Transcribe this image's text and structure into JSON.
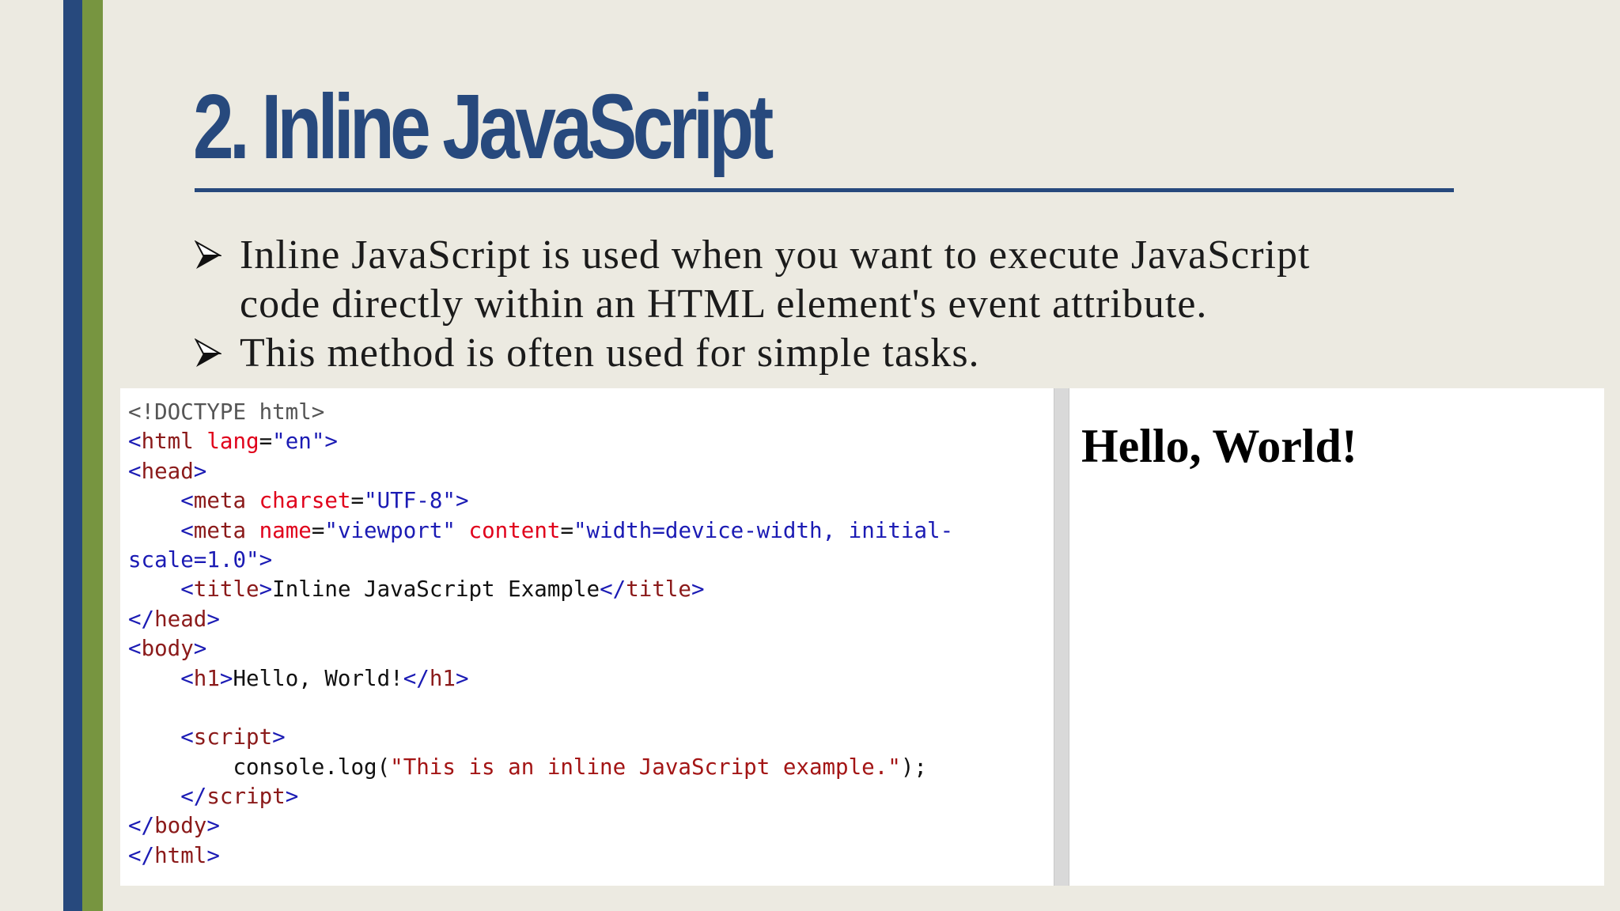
{
  "slide": {
    "title": "2. Inline JavaScript",
    "bullets": [
      {
        "lines": [
          "Inline JavaScript is used when you want to execute JavaScript",
          "code directly within an HTML element's event attribute."
        ],
        "icon": "arrow-bullet-icon"
      },
      {
        "lines": [
          "This method is often used for simple tasks."
        ],
        "icon": "arrow-bullet-icon"
      }
    ]
  },
  "code_example": {
    "lines": [
      [
        {
          "t": "<!DOCTYPE html>",
          "c": "doctype"
        }
      ],
      [
        {
          "t": "<",
          "c": "punct"
        },
        {
          "t": "html",
          "c": "tag"
        },
        {
          "t": " ",
          "c": "text"
        },
        {
          "t": "lang",
          "c": "attr"
        },
        {
          "t": "=",
          "c": "text"
        },
        {
          "t": "\"en\"",
          "c": "val"
        },
        {
          "t": ">",
          "c": "punct"
        }
      ],
      [
        {
          "t": "<",
          "c": "punct"
        },
        {
          "t": "head",
          "c": "tag"
        },
        {
          "t": ">",
          "c": "punct"
        }
      ],
      [
        {
          "t": "    ",
          "c": "text"
        },
        {
          "t": "<",
          "c": "punct"
        },
        {
          "t": "meta",
          "c": "tag"
        },
        {
          "t": " ",
          "c": "text"
        },
        {
          "t": "charset",
          "c": "attr"
        },
        {
          "t": "=",
          "c": "text"
        },
        {
          "t": "\"UTF-8\"",
          "c": "val"
        },
        {
          "t": ">",
          "c": "punct"
        }
      ],
      [
        {
          "t": "    ",
          "c": "text"
        },
        {
          "t": "<",
          "c": "punct"
        },
        {
          "t": "meta",
          "c": "tag"
        },
        {
          "t": " ",
          "c": "text"
        },
        {
          "t": "name",
          "c": "attr"
        },
        {
          "t": "=",
          "c": "text"
        },
        {
          "t": "\"viewport\"",
          "c": "val"
        },
        {
          "t": " ",
          "c": "text"
        },
        {
          "t": "content",
          "c": "attr"
        },
        {
          "t": "=",
          "c": "text"
        },
        {
          "t": "\"width=device-width, initial-",
          "c": "val"
        }
      ],
      [
        {
          "t": "scale=1.0\"",
          "c": "val"
        },
        {
          "t": ">",
          "c": "punct"
        }
      ],
      [
        {
          "t": "    ",
          "c": "text"
        },
        {
          "t": "<",
          "c": "punct"
        },
        {
          "t": "title",
          "c": "tag"
        },
        {
          "t": ">",
          "c": "punct"
        },
        {
          "t": "Inline JavaScript Example",
          "c": "text"
        },
        {
          "t": "</",
          "c": "punct"
        },
        {
          "t": "title",
          "c": "tag"
        },
        {
          "t": ">",
          "c": "punct"
        }
      ],
      [
        {
          "t": "</",
          "c": "punct"
        },
        {
          "t": "head",
          "c": "tag"
        },
        {
          "t": ">",
          "c": "punct"
        }
      ],
      [
        {
          "t": "<",
          "c": "punct"
        },
        {
          "t": "body",
          "c": "tag"
        },
        {
          "t": ">",
          "c": "punct"
        }
      ],
      [
        {
          "t": "    ",
          "c": "text"
        },
        {
          "t": "<",
          "c": "punct"
        },
        {
          "t": "h1",
          "c": "tag"
        },
        {
          "t": ">",
          "c": "punct"
        },
        {
          "t": "Hello, World!",
          "c": "text"
        },
        {
          "t": "</",
          "c": "punct"
        },
        {
          "t": "h1",
          "c": "tag"
        },
        {
          "t": ">",
          "c": "punct"
        }
      ],
      [
        {
          "t": "",
          "c": "text"
        }
      ],
      [
        {
          "t": "    ",
          "c": "text"
        },
        {
          "t": "<",
          "c": "punct"
        },
        {
          "t": "script",
          "c": "tag"
        },
        {
          "t": ">",
          "c": "punct"
        }
      ],
      [
        {
          "t": "        console.log(",
          "c": "text"
        },
        {
          "t": "\"This is an inline JavaScript example.\"",
          "c": "str"
        },
        {
          "t": ");",
          "c": "text"
        }
      ],
      [
        {
          "t": "    ",
          "c": "text"
        },
        {
          "t": "</",
          "c": "punct"
        },
        {
          "t": "script",
          "c": "tag"
        },
        {
          "t": ">",
          "c": "punct"
        }
      ],
      [
        {
          "t": "</",
          "c": "punct"
        },
        {
          "t": "body",
          "c": "tag"
        },
        {
          "t": ">",
          "c": "punct"
        }
      ],
      [
        {
          "t": "</",
          "c": "punct"
        },
        {
          "t": "html",
          "c": "tag"
        },
        {
          "t": ">",
          "c": "punct"
        }
      ]
    ]
  },
  "preview": {
    "heading": "Hello, World!"
  },
  "colors": {
    "background": "#eceae1",
    "accent_blue": "#27497d",
    "accent_green": "#779540",
    "code_tag": "#8b1a1a",
    "code_attr": "#e0001b",
    "code_value": "#1b1bb4"
  }
}
